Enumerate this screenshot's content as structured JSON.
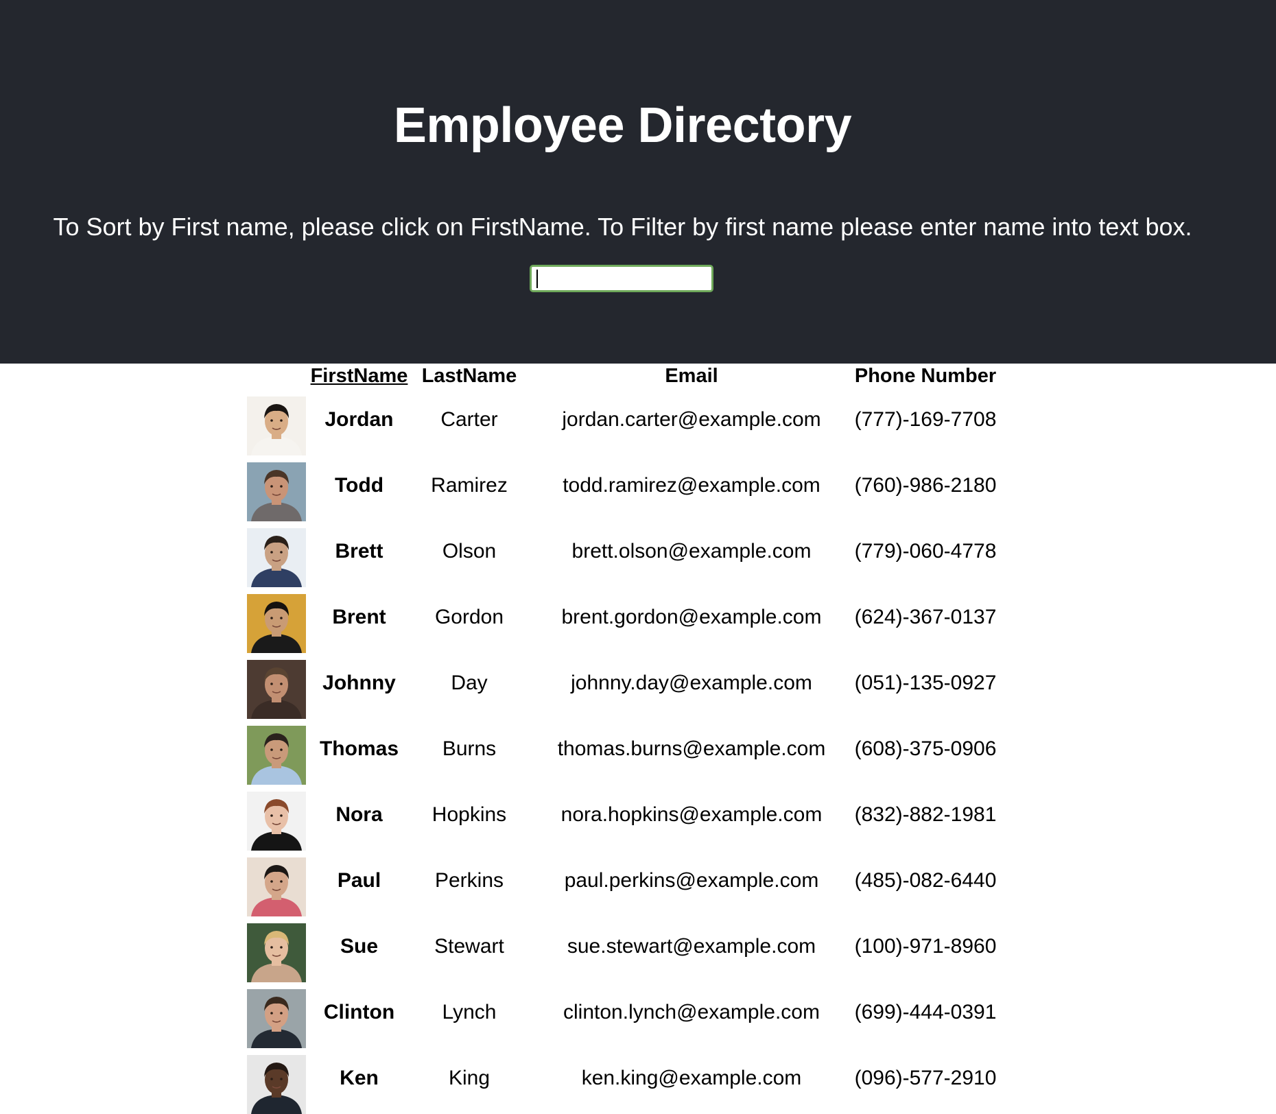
{
  "header": {
    "title": "Employee Directory",
    "instructions": "To Sort by First name, please click on FirstName. To Filter by first name please enter name into text box.",
    "filter_value": "",
    "filter_border_color": "#6fa95a",
    "background_color": "#24272e"
  },
  "table": {
    "columns": {
      "first_name": "FirstName",
      "last_name": "LastName",
      "email": "Email",
      "phone": "Phone Number"
    },
    "rows": [
      {
        "first": "Jordan",
        "last": "Carter",
        "email": "jordan.carter@example.com",
        "phone": "(777)-169-7708",
        "avatar": {
          "bg": "#f4f1ec",
          "skin": "#d9ad86",
          "hair": "#1a1512",
          "shirt": "#f6f4f0"
        }
      },
      {
        "first": "Todd",
        "last": "Ramirez",
        "email": "todd.ramirez@example.com",
        "phone": "(760)-986-2180",
        "avatar": {
          "bg": "#8aa3b3",
          "skin": "#c99477",
          "hair": "#4a3527",
          "shirt": "#6f6a6a"
        }
      },
      {
        "first": "Brett",
        "last": "Olson",
        "email": "brett.olson@example.com",
        "phone": "(779)-060-4778",
        "avatar": {
          "bg": "#e9eef3",
          "skin": "#c9a183",
          "hair": "#2a2019",
          "shirt": "#2f3f63"
        }
      },
      {
        "first": "Brent",
        "last": "Gordon",
        "email": "brent.gordon@example.com",
        "phone": "(624)-367-0137",
        "avatar": {
          "bg": "#d6a238",
          "skin": "#c99b74",
          "hair": "#16120f",
          "shirt": "#1a1a1a"
        }
      },
      {
        "first": "Johnny",
        "last": "Day",
        "email": "johnny.day@example.com",
        "phone": "(051)-135-0927",
        "avatar": {
          "bg": "#4d3b32",
          "skin": "#c28f72",
          "hair": "#5a4432",
          "shirt": "#3a2c26"
        }
      },
      {
        "first": "Thomas",
        "last": "Burns",
        "email": "thomas.burns@example.com",
        "phone": "(608)-375-0906",
        "avatar": {
          "bg": "#7f9a5a",
          "skin": "#c99a7a",
          "hair": "#2a221d",
          "shirt": "#a9c4e0"
        }
      },
      {
        "first": "Nora",
        "last": "Hopkins",
        "email": "nora.hopkins@example.com",
        "phone": "(832)-882-1981",
        "avatar": {
          "bg": "#f2f2f2",
          "skin": "#e8c0a8",
          "hair": "#8a4a2c",
          "shirt": "#151515"
        }
      },
      {
        "first": "Paul",
        "last": "Perkins",
        "email": "paul.perkins@example.com",
        "phone": "(485)-082-6440",
        "avatar": {
          "bg": "#e9ddd2",
          "skin": "#d4a68a",
          "hair": "#1c1715",
          "shirt": "#d35f6f"
        }
      },
      {
        "first": "Sue",
        "last": "Stewart",
        "email": "sue.stewart@example.com",
        "phone": "(100)-971-8960",
        "avatar": {
          "bg": "#3f5a3b",
          "skin": "#e5bea0",
          "hair": "#d9b877",
          "shirt": "#c8a58a"
        }
      },
      {
        "first": "Clinton",
        "last": "Lynch",
        "email": "clinton.lynch@example.com",
        "phone": "(699)-444-0391",
        "avatar": {
          "bg": "#9aa4a8",
          "skin": "#d3a084",
          "hair": "#3a2a1e",
          "shirt": "#232a33"
        }
      },
      {
        "first": "Ken",
        "last": "King",
        "email": "ken.king@example.com",
        "phone": "(096)-577-2910",
        "avatar": {
          "bg": "#e7e7e7",
          "skin": "#5a3a28",
          "hair": "#231813",
          "shirt": "#1f2630"
        }
      }
    ]
  }
}
